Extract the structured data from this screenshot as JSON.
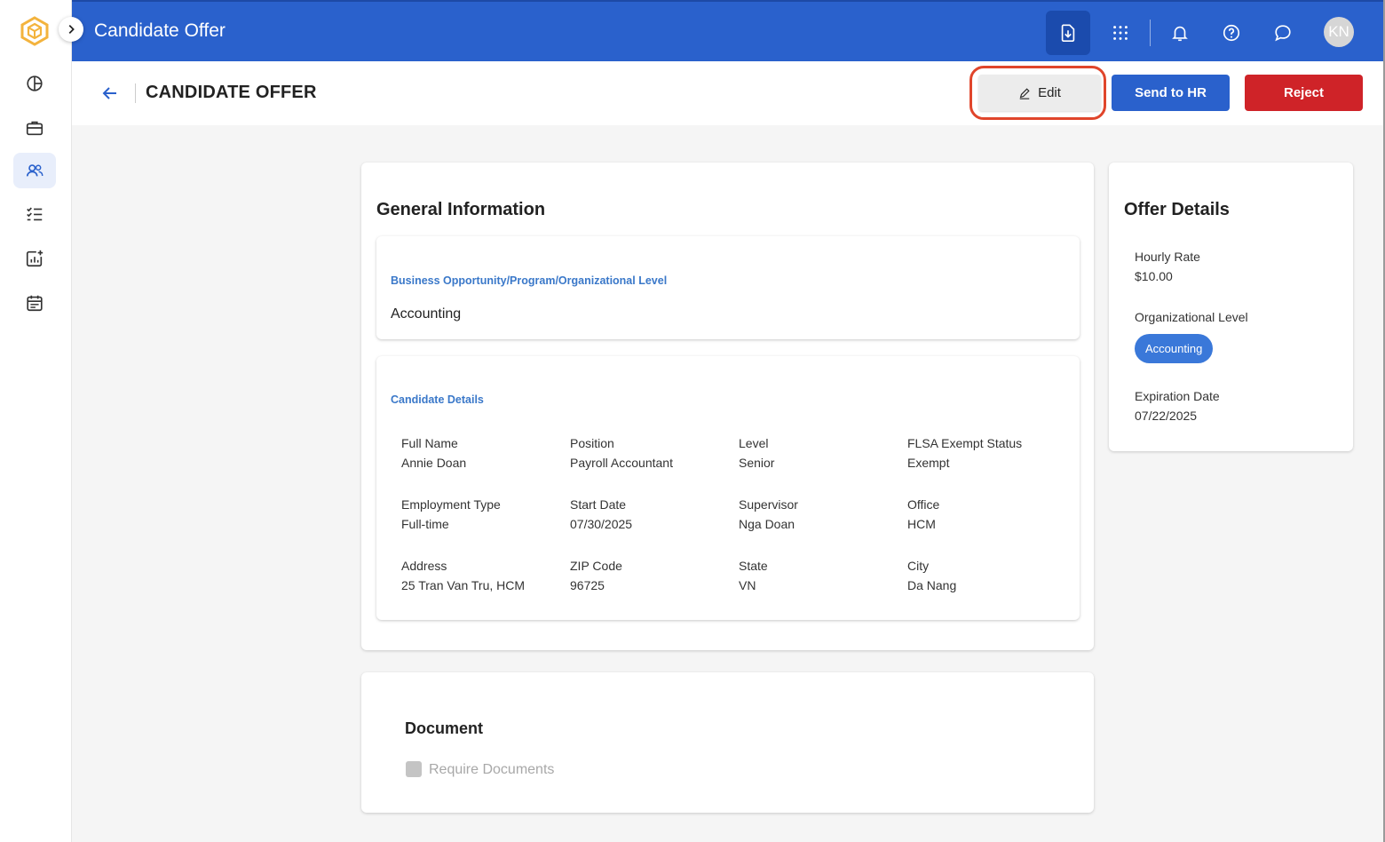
{
  "app": {
    "title": "Candidate Offer",
    "user_initials": "KN",
    "accent": "#2a61cc"
  },
  "sidebar": {
    "items": [
      {
        "name": "dashboard",
        "icon": "pie-chart-icon"
      },
      {
        "name": "jobs",
        "icon": "briefcase-icon"
      },
      {
        "name": "candidates",
        "icon": "users-icon",
        "active": true
      },
      {
        "name": "tasks",
        "icon": "checklist-icon"
      },
      {
        "name": "reports",
        "icon": "chart-add-icon"
      },
      {
        "name": "calendar",
        "icon": "calendar-icon"
      }
    ]
  },
  "topbar": {
    "icons": [
      "download-document-icon",
      "apps-grid-icon",
      "bell-icon",
      "help-icon",
      "chat-icon"
    ]
  },
  "header": {
    "title": "CANDIDATE OFFER",
    "edit_label": "Edit",
    "send_label": "Send to HR",
    "reject_label": "Reject"
  },
  "general": {
    "title": "General Information",
    "business": {
      "label": "Business Opportunity/Program/Organizational Level",
      "value": "Accounting"
    },
    "candidate": {
      "label": "Candidate Details",
      "fields": [
        {
          "label": "Full Name",
          "value": "Annie Doan"
        },
        {
          "label": "Position",
          "value": "Payroll Accountant"
        },
        {
          "label": "Level",
          "value": "Senior"
        },
        {
          "label": "FLSA Exempt Status",
          "value": "Exempt"
        },
        {
          "label": "Employment Type",
          "value": "Full-time"
        },
        {
          "label": "Start Date",
          "value": "07/30/2025"
        },
        {
          "label": "Supervisor",
          "value": "Nga Doan"
        },
        {
          "label": "Office",
          "value": "HCM"
        },
        {
          "label": "Address",
          "value": "25 Tran Van Tru, HCM"
        },
        {
          "label": "ZIP Code",
          "value": "96725"
        },
        {
          "label": "State",
          "value": "VN"
        },
        {
          "label": "City",
          "value": "Da Nang"
        }
      ]
    }
  },
  "offer": {
    "title": "Offer Details",
    "hourly_rate_label": "Hourly Rate",
    "hourly_rate_value": "$10.00",
    "org_level_label": "Organizational Level",
    "org_level_value": "Accounting",
    "expiration_label": "Expiration Date",
    "expiration_value": "07/22/2025"
  },
  "document": {
    "title": "Document",
    "require_label": "Require Documents",
    "require_checked": false
  }
}
